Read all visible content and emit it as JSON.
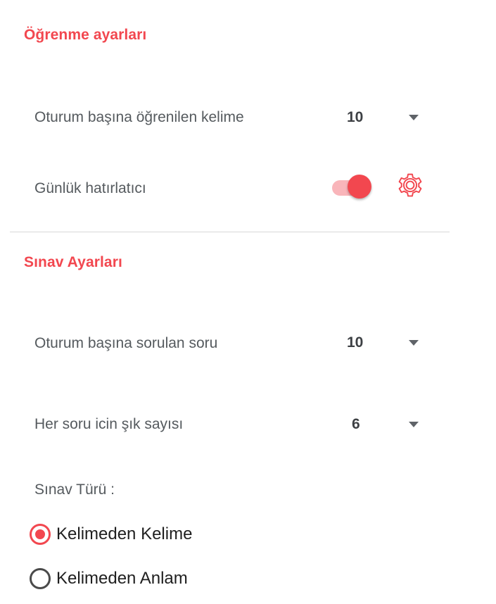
{
  "colors": {
    "accent": "#f2474f",
    "accent_light": "#f9b5ba",
    "label": "#555a5e",
    "divider": "#d8d8d8"
  },
  "learning": {
    "title": "Öğrenme ayarları",
    "words_per_session": {
      "label": "Oturum başına öğrenilen kelime",
      "value": "10",
      "icon": "caret-down-icon"
    },
    "daily_reminder": {
      "label": "Günlük hatırlatıcı",
      "enabled": true,
      "settings_icon": "gear-icon"
    }
  },
  "exam": {
    "title": "Sınav Ayarları",
    "questions_per_session": {
      "label": "Oturum başına sorulan soru",
      "value": "10",
      "icon": "caret-down-icon"
    },
    "choices_per_question": {
      "label": "Her soru icin şık sayısı",
      "value": "6",
      "icon": "caret-down-icon"
    },
    "exam_type": {
      "label": "Sınav Türü :",
      "options": [
        {
          "label": "Kelimeden Kelime",
          "selected": true
        },
        {
          "label": "Kelimeden Anlam",
          "selected": false
        }
      ]
    }
  }
}
